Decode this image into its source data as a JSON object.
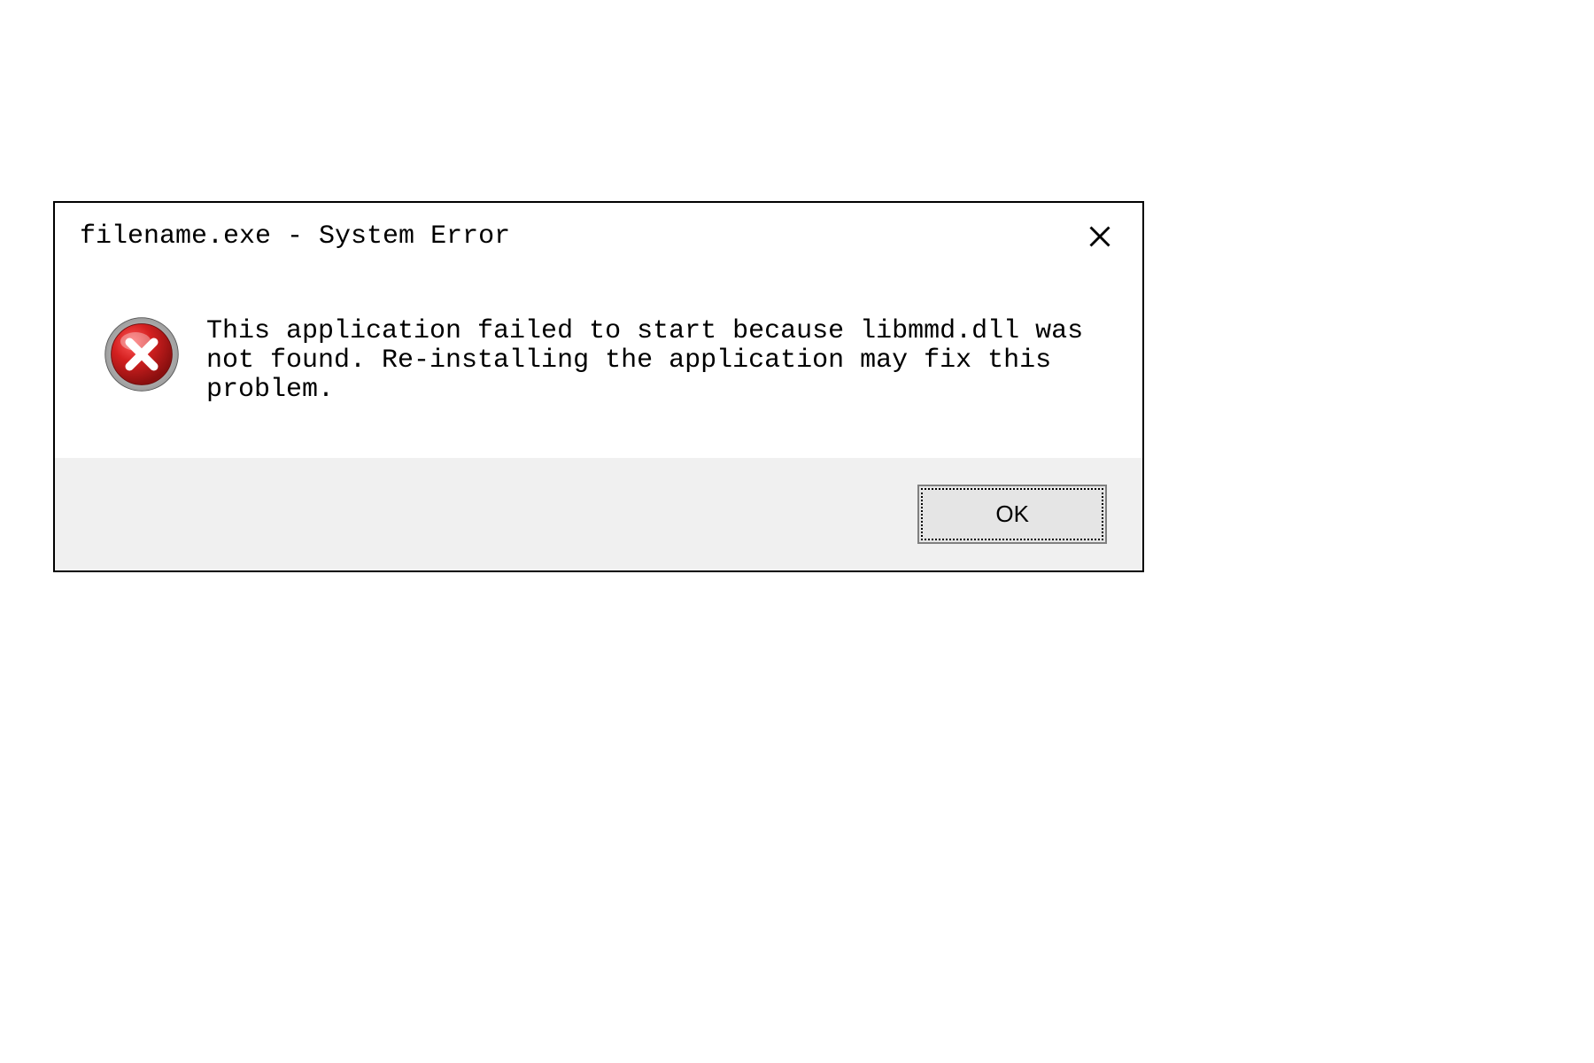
{
  "dialog": {
    "title": "filename.exe - System Error",
    "message": "This application failed to start because libmmd.dll was not found. Re-installing the application may fix this problem.",
    "ok_label": "OK",
    "icon": "error-icon",
    "colors": {
      "icon_red_outer": "#a01818",
      "icon_red_mid": "#c82020",
      "icon_red_center": "#e03030",
      "button_bg": "#e5e5e5",
      "button_row_bg": "#f0f0f0"
    }
  }
}
